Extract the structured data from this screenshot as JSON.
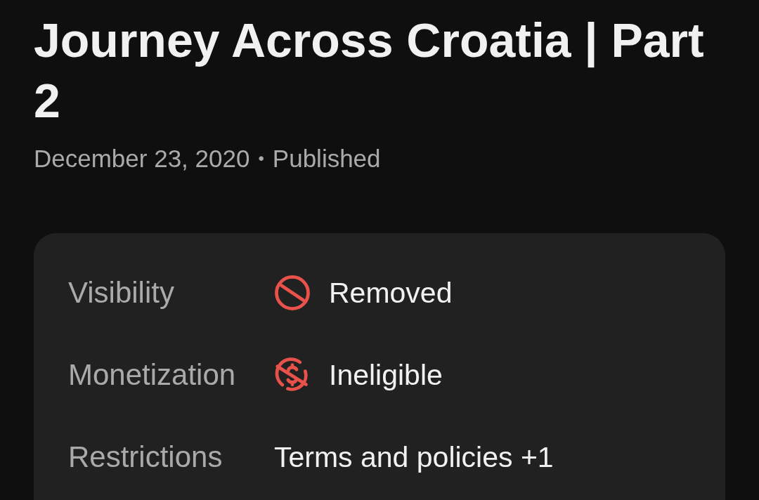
{
  "title": "Journey Across Croatia | Part 2",
  "meta": {
    "date": "December 23, 2020",
    "separator": "•",
    "status": "Published"
  },
  "details": [
    {
      "label": "Visibility",
      "kind": "ban",
      "value": "Removed"
    },
    {
      "label": "Monetization",
      "kind": "nomoney",
      "value": "Ineligible"
    },
    {
      "label": "Restrictions",
      "kind": "plain",
      "value": "Terms and policies +1"
    }
  ]
}
